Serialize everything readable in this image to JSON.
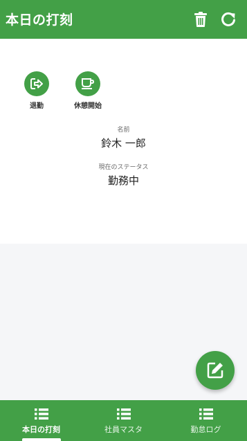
{
  "header": {
    "title": "本日の打刻",
    "icons": [
      "trash-icon",
      "refresh-icon"
    ],
    "color": "#43a047"
  },
  "actions": [
    {
      "label": "退勤",
      "icon": "logout-icon"
    },
    {
      "label": "休憩開始",
      "icon": "coffee-icon"
    }
  ],
  "employee": {
    "name_caption": "名前",
    "name": "鈴木 一郎",
    "status_caption": "現在のステータス",
    "status": "勤務中"
  },
  "fab": {
    "icon": "edit-icon"
  },
  "bottom_nav": {
    "items": [
      {
        "label": "本日の打刻",
        "icon": "list-icon",
        "active": true
      },
      {
        "label": "社員マスタ",
        "icon": "list-icon",
        "active": false
      },
      {
        "label": "勤怠ログ",
        "icon": "list-icon",
        "active": false
      }
    ]
  },
  "colors": {
    "accent": "#43a047",
    "background": "#f5f6f8",
    "surface": "#ffffff"
  }
}
